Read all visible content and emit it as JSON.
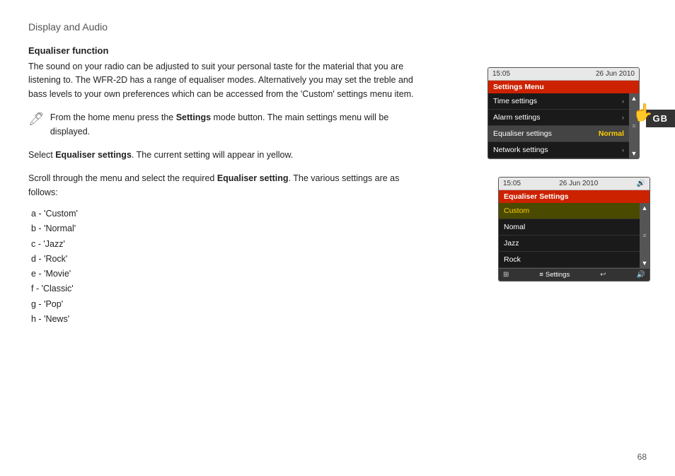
{
  "page": {
    "title": "Display and Audio",
    "section_heading": "Equaliser function",
    "body_text": "The sound on your radio can be adjusted to suit your personal taste for the material that you are listening to. The WFR-2D has a range of equaliser modes. Alternatively you may set the treble and bass levels to your own preferences which can be accessed from the 'Custom' settings menu item.",
    "note_text": "From the home menu press the ",
    "note_bold": "Settings",
    "note_text2": " mode button. The main settings menu will be displayed.",
    "select_text": "Select ",
    "select_bold": "Equaliser settings",
    "select_text2": ". The current setting will appear in yellow.",
    "scroll_text": "Scroll through the menu and select the required ",
    "scroll_bold": "Equaliser setting",
    "scroll_text2": ". The various settings are as follows:",
    "list_items": [
      "a - 'Custom'",
      "b - 'Normal'",
      "c - 'Jazz'",
      "d - 'Rock'",
      "e - 'Movie'",
      "f - 'Classic'",
      "g - 'Pop'",
      "h - 'News'"
    ],
    "gb_label": "GB",
    "page_number": "68"
  },
  "screen1": {
    "time": "15:05",
    "date": "26 Jun 2010",
    "title": "Settings Menu",
    "menu_items": [
      {
        "label": "Time settings",
        "arrow": "›",
        "highlight": false
      },
      {
        "label": "Alarm settings",
        "arrow": "›",
        "highlight": false
      },
      {
        "label": "Equaliser settings",
        "extra": "Normal",
        "highlight": true
      },
      {
        "label": "Network settings",
        "arrow": "›",
        "highlight": false
      }
    ]
  },
  "screen2": {
    "time": "15:05",
    "date": "26 Jun 2010",
    "title": "Equaliser Settings",
    "items": [
      "Custom",
      "Nomal",
      "Jazz",
      "Rock"
    ],
    "selected_index": 0,
    "footer_settings": "Settings"
  }
}
